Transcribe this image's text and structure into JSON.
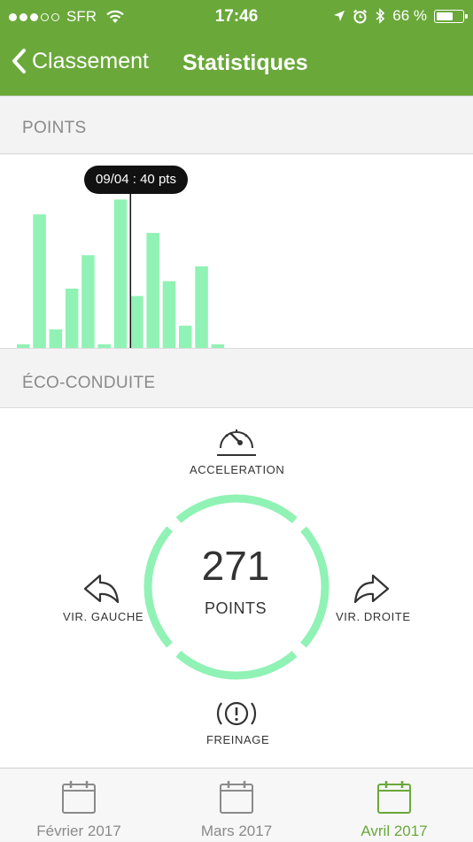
{
  "status_bar": {
    "carrier": "SFR",
    "time": "17:46",
    "battery": "66 %",
    "battery_level": 0.66
  },
  "nav": {
    "back_label": "Classement",
    "title": "Statistiques"
  },
  "sections": {
    "points": "POINTS",
    "eco": "ÉCO-CONDUITE"
  },
  "tooltip": "09/04 : 40 pts",
  "chart_data": {
    "type": "bar",
    "ylim": [
      0,
      42
    ],
    "values": [
      1,
      36,
      5,
      16,
      25,
      1,
      40,
      14,
      31,
      18,
      6,
      22,
      1
    ],
    "selected_index": 6,
    "bar_color": "#90f2b4"
  },
  "eco": {
    "acceleration": "ACCELERATION",
    "vir_gauche": "VIR. GAUCHE",
    "vir_droite": "VIR. DROITE",
    "freinage": "FREINAGE",
    "score": "271",
    "score_label": "POINTS",
    "ring_color": "#90f2b4"
  },
  "tabs": [
    {
      "label": "Février 2017",
      "active": false
    },
    {
      "label": "Mars 2017",
      "active": false
    },
    {
      "label": "Avril 2017",
      "active": true
    }
  ],
  "colors": {
    "header": "#6aa83a",
    "active_tab": "#6aa83a",
    "inactive_tab": "#8a8a8a"
  }
}
